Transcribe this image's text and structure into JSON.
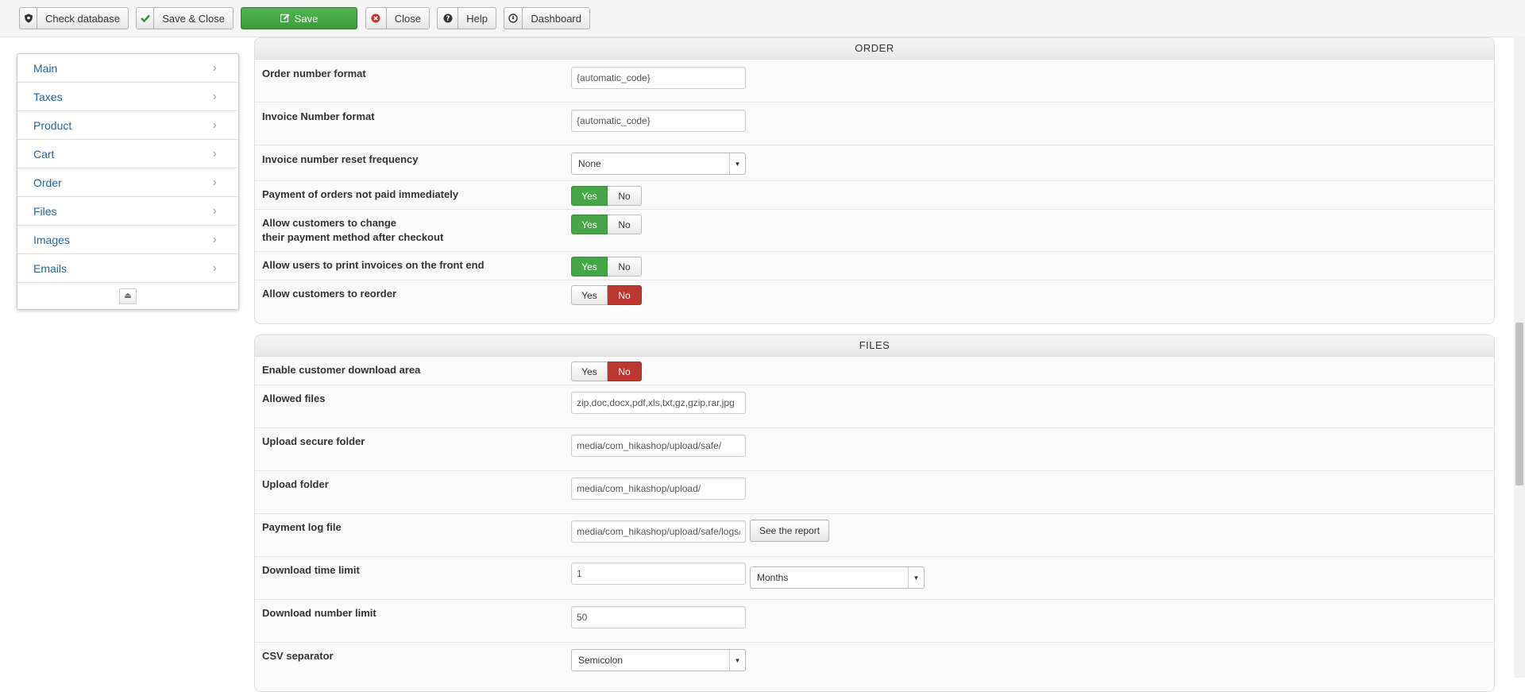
{
  "toolbar": {
    "check_database": "Check database",
    "save_close": "Save & Close",
    "save": "Save",
    "close": "Close",
    "help": "Help",
    "dashboard": "Dashboard"
  },
  "sidebar": {
    "items": [
      {
        "label": "Main"
      },
      {
        "label": "Taxes"
      },
      {
        "label": "Product"
      },
      {
        "label": "Cart"
      },
      {
        "label": "Order"
      },
      {
        "label": "Files"
      },
      {
        "label": "Images"
      },
      {
        "label": "Emails"
      }
    ]
  },
  "order": {
    "title": "ORDER",
    "order_number_format": {
      "label": "Order number format",
      "value": "{automatic_code}"
    },
    "invoice_number_format": {
      "label": "Invoice Number format",
      "value": "{automatic_code}"
    },
    "invoice_reset": {
      "label": "Invoice number reset frequency",
      "value": "None"
    },
    "payment_not_paid": {
      "label": "Payment of orders not paid immediately",
      "value": "Yes"
    },
    "change_payment": {
      "label_line1": "Allow customers to change",
      "label_line2": "their payment method after checkout",
      "value": "Yes"
    },
    "print_invoices": {
      "label": "Allow users to print invoices on the front end",
      "value": "Yes"
    },
    "reorder": {
      "label": "Allow customers to reorder",
      "value": "No"
    }
  },
  "files": {
    "title": "FILES",
    "download_area": {
      "label": "Enable customer download area",
      "value": "No"
    },
    "allowed_files": {
      "label": "Allowed files",
      "value": "zip,doc,docx,pdf,xls,txt,gz,gzip,rar,jpg"
    },
    "upload_secure_folder": {
      "label": "Upload secure folder",
      "value": "media/com_hikashop/upload/safe/"
    },
    "upload_folder": {
      "label": "Upload folder",
      "value": "media/com_hikashop/upload/"
    },
    "payment_log": {
      "label": "Payment log file",
      "value": "media/com_hikashop/upload/safe/logs/",
      "button": "See the report"
    },
    "download_time": {
      "label": "Download time limit",
      "value": "1",
      "unit": "Months"
    },
    "download_number": {
      "label": "Download number limit",
      "value": "50"
    },
    "csv_separator": {
      "label": "CSV separator",
      "value": "Semicolon"
    }
  },
  "switch": {
    "yes": "Yes",
    "no": "No"
  },
  "colors": {
    "yes_active": "#46a546",
    "no_active": "#bd362f",
    "link": "#2a6496",
    "save_green": "#46a546"
  }
}
